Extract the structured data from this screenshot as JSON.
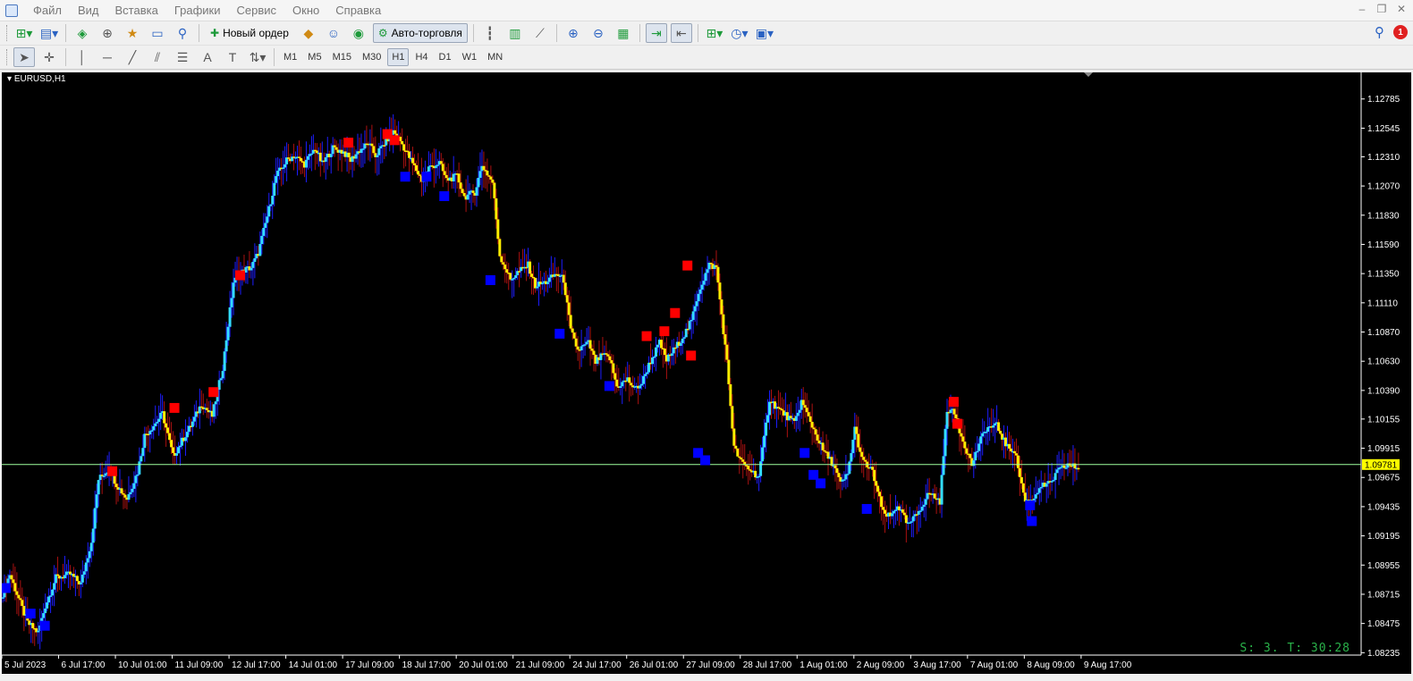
{
  "menu": [
    "Файл",
    "Вид",
    "Вставка",
    "Графики",
    "Сервис",
    "Окно",
    "Справка"
  ],
  "toolbar": {
    "new_order_label": "Новый ордер",
    "auto_trading_label": "Авто-торговля",
    "notification_count": "1"
  },
  "timeframes": [
    "M1",
    "M5",
    "M15",
    "M30",
    "H1",
    "H4",
    "D1",
    "W1",
    "MN"
  ],
  "active_timeframe": "H1",
  "chart": {
    "symbol_title": "EURUSD,H1",
    "status": "S: 3.  T: 30:28"
  },
  "colors": {
    "background": "#000000",
    "up_color": "#33ddff",
    "down_color": "#ffee00",
    "wick_up": "#1d1dff",
    "wick_down": "#aa1111",
    "bid_line": "#9dff9d",
    "sell_marker": "#ff0000",
    "buy_marker": "#0000ff",
    "axis_text": "#ffffff",
    "status_text": "#2ab34a"
  },
  "chart_data": {
    "type": "line",
    "y_ticks": [
      1.12785,
      1.12545,
      1.1231,
      1.1207,
      1.1183,
      1.1159,
      1.1135,
      1.1111,
      1.1087,
      1.1063,
      1.1039,
      1.10155,
      1.09915,
      1.09675,
      1.09435,
      1.09195,
      1.08955,
      1.08715,
      1.08475,
      1.08235
    ],
    "ylim": [
      1.0823,
      1.1293
    ],
    "current_price": 1.09781,
    "x_ticks": [
      "5 Jul 2023",
      "6 Jul 17:00",
      "10 Jul 01:00",
      "11 Jul 09:00",
      "12 Jul 17:00",
      "14 Jul 01:00",
      "17 Jul 09:00",
      "18 Jul 17:00",
      "20 Jul 01:00",
      "21 Jul 09:00",
      "24 Jul 17:00",
      "26 Jul 01:00",
      "27 Jul 09:00",
      "28 Jul 17:00",
      "1 Aug 01:00",
      "2 Aug 09:00",
      "3 Aug 17:00",
      "7 Aug 01:00",
      "8 Aug 09:00",
      "9 Aug 17:00"
    ],
    "bars_per_tick": 32,
    "series": [
      {
        "x": [
          0,
          4,
          9,
          14,
          20,
          24,
          30,
          38,
          44,
          50,
          54,
          60,
          64,
          70,
          76,
          80,
          86,
          90,
          96,
          102,
          106,
          112,
          118,
          124,
          130,
          136,
          140,
          144,
          150,
          154,
          160,
          164,
          170,
          176,
          180,
          186,
          192,
          196,
          200,
          206,
          210,
          216,
          220,
          224,
          230,
          236,
          240,
          246,
          250,
          256,
          260,
          266,
          270,
          276,
          280,
          286,
          290,
          296,
          300,
          306,
          312,
          316,
          320,
          324,
          330,
          334,
          338,
          342,
          346,
          352,
          356,
          360,
          364,
          370,
          374,
          378,
          384,
          388,
          392,
          398,
          402,
          408,
          412,
          416,
          420,
          426,
          432,
          436,
          440,
          446,
          450,
          456,
          462,
          468,
          472,
          476,
          480,
          484,
          490,
          496,
          500,
          504,
          510,
          514,
          518,
          522,
          528,
          532,
          536,
          540,
          546,
          550,
          554,
          560,
          566,
          570,
          576,
          580,
          584,
          590,
          594,
          600,
          606
        ],
        "values": [
          1.0872,
          1.0888,
          1.0868,
          1.0848,
          1.084,
          1.0862,
          1.0885,
          1.0888,
          1.088,
          1.0915,
          1.0966,
          1.0975,
          1.0962,
          1.095,
          1.0972,
          1.1002,
          1.1012,
          1.102,
          1.0985,
          1.1,
          1.101,
          1.1028,
          1.1018,
          1.1058,
          1.1128,
          1.1138,
          1.114,
          1.1152,
          1.1188,
          1.1215,
          1.1228,
          1.1232,
          1.1225,
          1.1238,
          1.1225,
          1.1238,
          1.1235,
          1.1228,
          1.1235,
          1.1242,
          1.1232,
          1.1244,
          1.1252,
          1.1244,
          1.1228,
          1.1212,
          1.1222,
          1.1226,
          1.1212,
          1.1215,
          1.1198,
          1.1202,
          1.1224,
          1.121,
          1.115,
          1.113,
          1.1136,
          1.1142,
          1.1125,
          1.1128,
          1.1135,
          1.113,
          1.1088,
          1.1072,
          1.1078,
          1.1062,
          1.1068,
          1.1065,
          1.1042,
          1.1048,
          1.104,
          1.1045,
          1.106,
          1.1078,
          1.1064,
          1.1072,
          1.1085,
          1.1096,
          1.112,
          1.1142,
          1.114,
          1.1062,
          1.0992,
          1.098,
          1.0975,
          1.0968,
          1.1032,
          1.1025,
          1.102,
          1.1012,
          1.103,
          1.101,
          1.099,
          1.0978,
          1.0962,
          1.097,
          1.1008,
          1.0982,
          1.0972,
          1.0938,
          1.0935,
          1.0945,
          1.0928,
          1.0935,
          1.0945,
          1.0955,
          1.0948,
          1.1024,
          1.102,
          1.1002,
          1.0978,
          1.0995,
          1.1008,
          1.101,
          1.0992,
          1.099,
          1.0948,
          1.0948,
          1.096,
          1.0962,
          1.0972,
          1.0978,
          1.0975
        ]
      }
    ],
    "sell_signals": [
      [
        62,
        1.0973
      ],
      [
        97,
        1.1025
      ],
      [
        119,
        1.1038
      ],
      [
        134,
        1.1134
      ],
      [
        195,
        1.1243
      ],
      [
        217,
        1.125
      ],
      [
        221,
        1.1245
      ],
      [
        363,
        1.1084
      ],
      [
        373,
        1.1088
      ],
      [
        379,
        1.1103
      ],
      [
        386,
        1.1142
      ],
      [
        388,
        1.1068
      ],
      [
        536,
        1.103
      ],
      [
        538,
        1.1012
      ]
    ],
    "buy_signals": [
      [
        2,
        1.0877
      ],
      [
        16,
        1.0856
      ],
      [
        24,
        1.0846
      ],
      [
        227,
        1.1215
      ],
      [
        239,
        1.1215
      ],
      [
        249,
        1.1199
      ],
      [
        275,
        1.113
      ],
      [
        314,
        1.1086
      ],
      [
        342,
        1.1043
      ],
      [
        392,
        1.0988
      ],
      [
        396,
        1.0982
      ],
      [
        452,
        1.0988
      ],
      [
        457,
        1.097
      ],
      [
        461,
        1.0963
      ],
      [
        487,
        1.0942
      ],
      [
        579,
        1.0945
      ],
      [
        580,
        1.0932
      ]
    ],
    "grid": false
  }
}
